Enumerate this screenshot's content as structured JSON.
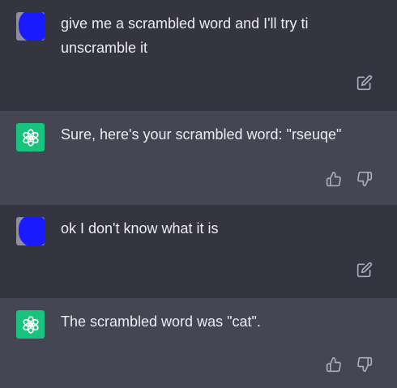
{
  "conversation": {
    "messages": [
      {
        "role": "user",
        "text": "give me a scrambled word and I'll try ti\nunscramble it",
        "actions": [
          "edit-icon"
        ]
      },
      {
        "role": "assistant",
        "text": "Sure, here's your scrambled word: \"rseuqe\"",
        "actions": [
          "thumbs-up-icon",
          "thumbs-down-icon"
        ]
      },
      {
        "role": "user",
        "text": "ok I don't know what it is",
        "actions": [
          "edit-icon"
        ]
      },
      {
        "role": "assistant",
        "text": "The scrambled word was \"cat\".",
        "actions": [
          "thumbs-up-icon",
          "thumbs-down-icon"
        ]
      }
    ]
  },
  "colors": {
    "user_bg": "#343541",
    "assistant_bg": "#444654",
    "bot_avatar": "#19c37d",
    "user_avatar_scribble": "#1a1aff",
    "text": "#ececf1",
    "icon": "#acacbe"
  }
}
